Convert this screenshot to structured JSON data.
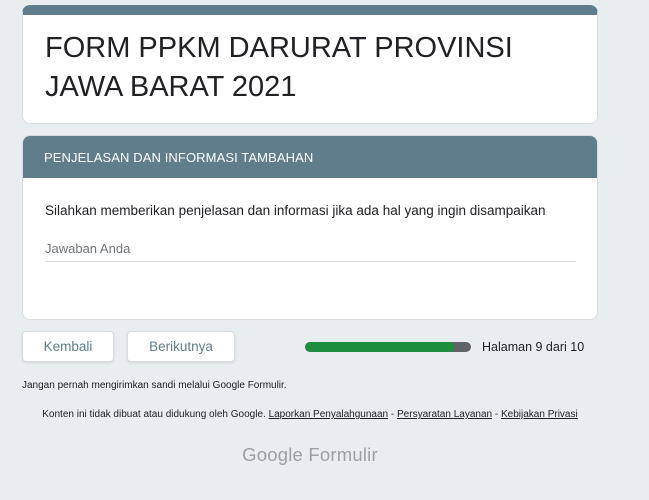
{
  "form": {
    "title": "FORM PPKM DARURAT PROVINSI JAWA BARAT 2021",
    "accent_color": "#607d8b"
  },
  "section": {
    "header": "PENJELASAN DAN INFORMASI TAMBAHAN",
    "question": "Silahkan memberikan penjelasan dan informasi jika ada hal yang ingin disampaikan",
    "answer_placeholder": "Jawaban Anda"
  },
  "navigation": {
    "back_label": "Kembali",
    "next_label": "Berikutnya",
    "progress_text": "Halaman 9 dari 10",
    "progress_fraction": 0.9,
    "progress_color": "#1e8e3e"
  },
  "footer": {
    "warning": "Jangan pernah mengirimkan sandi melalui Google Formulir.",
    "disclaimer_prefix": "Konten ini tidak dibuat atau didukung oleh Google.",
    "link_abuse": "Laporkan Penyalahgunaan",
    "separator": "-",
    "link_terms": "Persyaratan Layanan",
    "link_privacy": "Kebijakan Privasi",
    "brand_google": "Google",
    "brand_product": "Formulir"
  }
}
